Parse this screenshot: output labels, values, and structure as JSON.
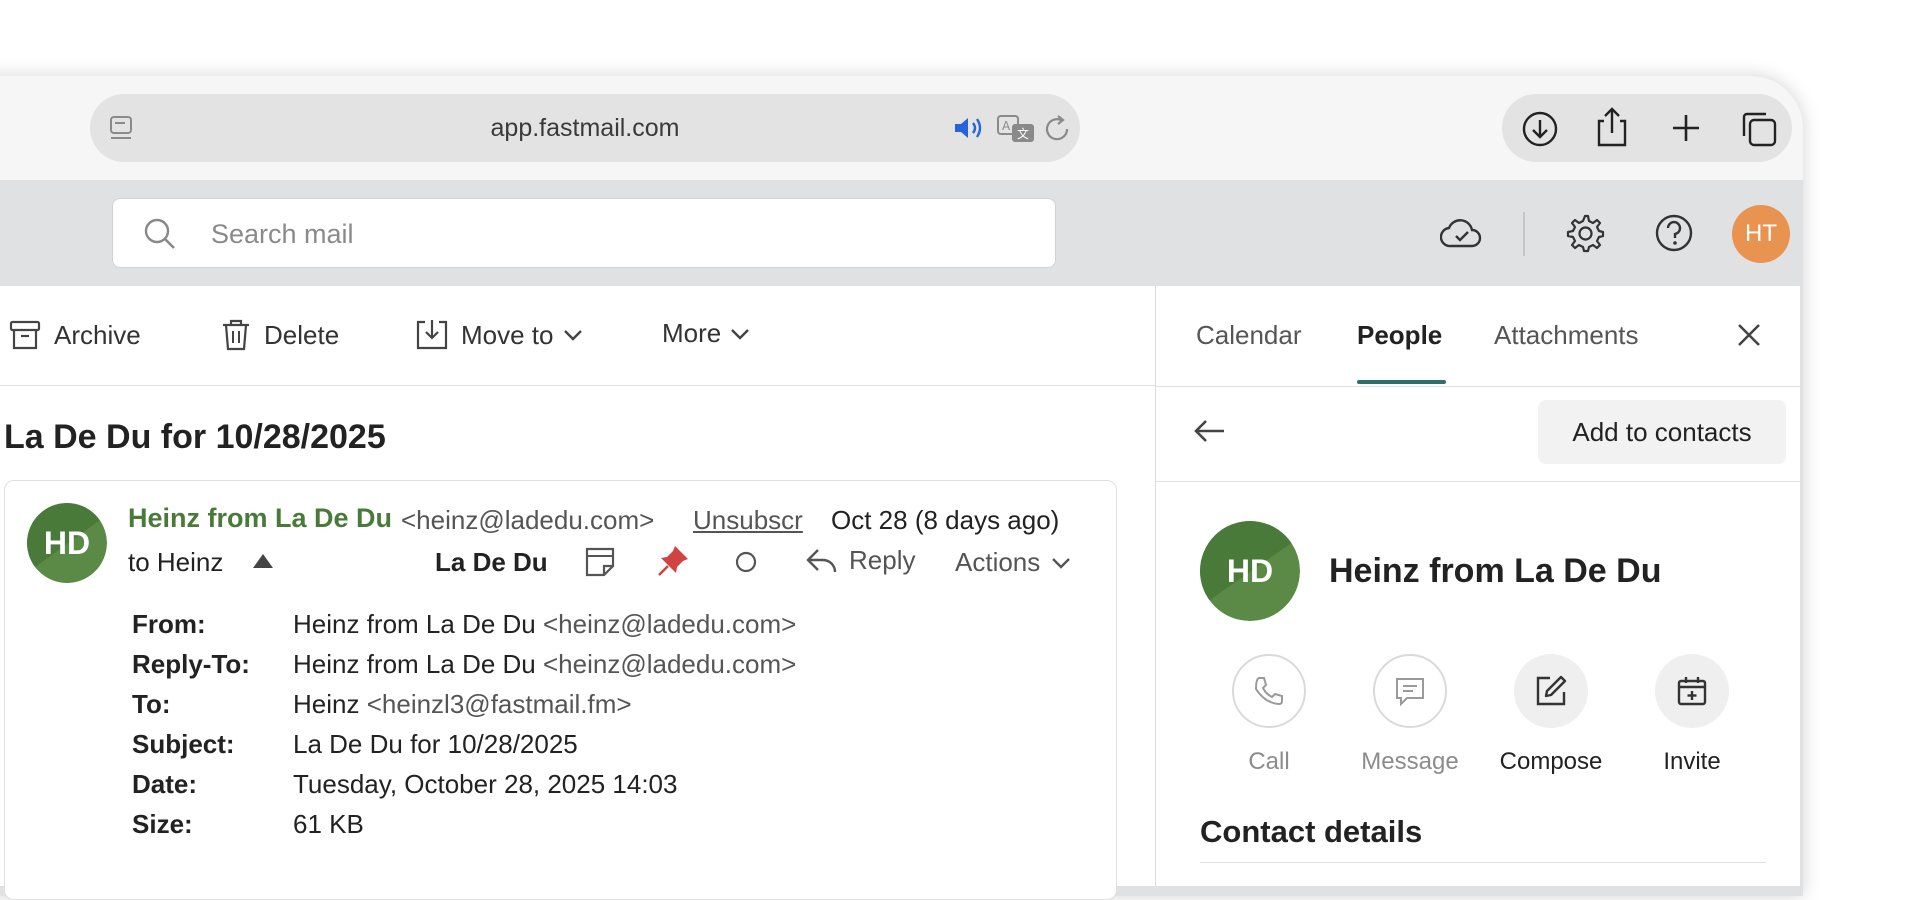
{
  "browser": {
    "url": "app.fastmail.com"
  },
  "search": {
    "placeholder": "Search mail"
  },
  "user": {
    "initials": "HT",
    "avatar_color": "#e8934f"
  },
  "toolbar": {
    "archive_label": "Archive",
    "delete_label": "Delete",
    "move_to_label": "Move to",
    "more_label": "More"
  },
  "message": {
    "subject_title": "La De Du for 10/28/2025",
    "sender_initials": "HD",
    "sender_name": "Heinz from La De Du",
    "sender_email": "<heinz@ladedu.com>",
    "unsubscribe_label": "Unsubscr",
    "date_summary": "Oct 28 (8 days ago)",
    "to_summary": "to Heinz",
    "label_tag": "La De Du",
    "reply_label": "Reply",
    "actions_label": "Actions",
    "accent_color": "#4a7a3a",
    "details": {
      "from_label": "From:",
      "from_name": "Heinz from La De Du",
      "from_email": "<heinz@ladedu.com>",
      "reply_to_label": "Reply-To:",
      "reply_to_name": "Heinz from La De Du",
      "reply_to_email": "<heinz@ladedu.com>",
      "to_label": "To:",
      "to_name": "Heinz",
      "to_email": "<heinzl3@fastmail.fm>",
      "subject_label": "Subject:",
      "subject_value": "La De Du for 10/28/2025",
      "date_label": "Date:",
      "date_value": "Tuesday, October 28, 2025 14:03",
      "size_label": "Size:",
      "size_value": "61 KB"
    }
  },
  "side_panel": {
    "tabs": [
      {
        "label": "Calendar",
        "active": false
      },
      {
        "label": "People",
        "active": true
      },
      {
        "label": "Attachments",
        "active": false
      }
    ],
    "active_tab_color": "#2f6f6a",
    "add_to_contacts_label": "Add to contacts",
    "contact": {
      "initials": "HD",
      "name": "Heinz from La De Du"
    },
    "actions": [
      {
        "label": "Call",
        "icon": "phone-icon",
        "enabled": false
      },
      {
        "label": "Message",
        "icon": "chat-icon",
        "enabled": false
      },
      {
        "label": "Compose",
        "icon": "compose-icon",
        "enabled": true
      },
      {
        "label": "Invite",
        "icon": "calendar-plus-icon",
        "enabled": true
      }
    ],
    "contact_details_heading": "Contact details"
  }
}
